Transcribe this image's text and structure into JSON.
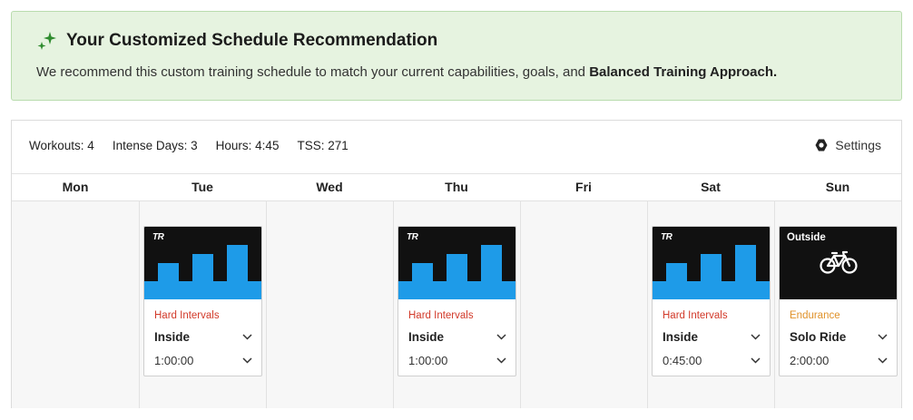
{
  "banner": {
    "title": "Your Customized Schedule Recommendation",
    "text": "We recommend this custom training schedule to match your current capabilities, goals, and",
    "text_bold": "Balanced Training Approach."
  },
  "stats": [
    {
      "label": "Workouts:",
      "value": "4"
    },
    {
      "label": "Intense Days:",
      "value": "3"
    },
    {
      "label": "Hours:",
      "value": "4:45"
    },
    {
      "label": "TSS:",
      "value": "271"
    }
  ],
  "settings_label": "Settings",
  "days": [
    "Mon",
    "Tue",
    "Wed",
    "Thu",
    "Fri",
    "Sat",
    "Sun"
  ],
  "workouts": {
    "tue": {
      "logo": "TR",
      "type": "Hard Intervals",
      "location": "Inside",
      "duration": "1:00:00"
    },
    "thu": {
      "logo": "TR",
      "type": "Hard Intervals",
      "location": "Inside",
      "duration": "1:00:00"
    },
    "sat": {
      "logo": "TR",
      "type": "Hard Intervals",
      "location": "Inside",
      "duration": "0:45:00"
    },
    "sun": {
      "thumb_label": "Outside",
      "type": "Endurance",
      "location": "Solo Ride",
      "duration": "2:00:00"
    }
  },
  "colors": {
    "accent_blue": "#1e9be8",
    "hard": "#d23a2a",
    "endurance": "#e0922a",
    "banner_bg": "#e6f3e0",
    "sparkle": "#2e8b2e"
  },
  "icons": {
    "banner": "sparkle-icon",
    "settings": "hexagon-icon",
    "outside": "bicycle-icon",
    "dropdown": "chevron-down-icon"
  }
}
